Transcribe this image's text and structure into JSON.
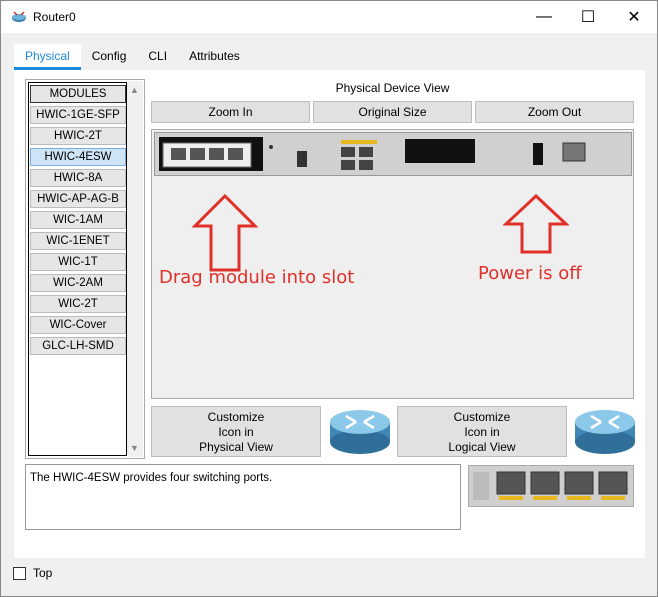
{
  "window": {
    "title": "Router0",
    "minimize_glyph": "—",
    "maximize_glyph": "☐",
    "close_glyph": "✕"
  },
  "tabs": [
    "Physical",
    "Config",
    "CLI",
    "Attributes"
  ],
  "active_tab": "Physical",
  "modules": {
    "header": "MODULES",
    "items": [
      "HWIC-1GE-SFP",
      "HWIC-2T",
      "HWIC-4ESW",
      "HWIC-8A",
      "HWIC-AP-AG-B",
      "WIC-1AM",
      "WIC-1ENET",
      "WIC-1T",
      "WIC-2AM",
      "WIC-2T",
      "WIC-Cover",
      "GLC-LH-SMD"
    ],
    "selected": "HWIC-4ESW"
  },
  "device_view": {
    "label": "Physical Device View",
    "zoom_in": "Zoom In",
    "original_size": "Original Size",
    "zoom_out": "Zoom Out"
  },
  "annotations": {
    "drag_text": "Drag module into slot",
    "power_text": "Power is off",
    "color": "#e0302a"
  },
  "customize": {
    "physical": [
      "Customize",
      "Icon in",
      "Physical View"
    ],
    "logical": [
      "Customize",
      "Icon in",
      "Logical View"
    ]
  },
  "info_text": "The HWIC-4ESW provides four switching ports.",
  "top_checkbox_label": "Top",
  "colors": {
    "accent": "#1f88d8",
    "router_icon": "#4a8db3"
  },
  "icons": [
    "router-app-icon",
    "router-icon"
  ]
}
